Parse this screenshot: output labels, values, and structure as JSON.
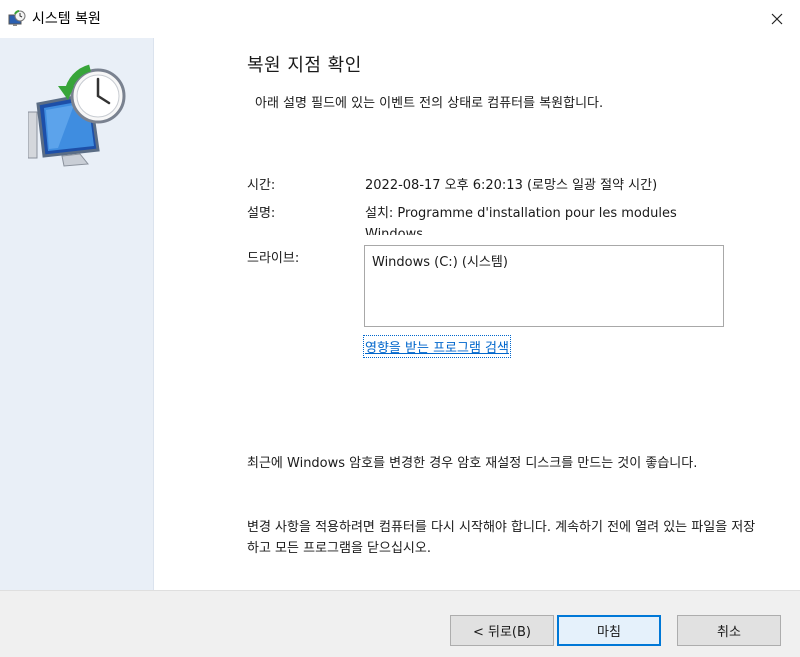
{
  "window": {
    "title": "시스템 복원"
  },
  "content": {
    "heading": "복원 지점 확인",
    "subheading": "아래 설명 필드에 있는 이벤트 전의 상태로 컴퓨터를 복원합니다.",
    "time_label": "시간:",
    "time_value": "2022-08-17 오후 6:20:13 (로망스 일광 절약 시간)",
    "desc_label": "설명:",
    "desc_value": "설치: Programme d'installation pour les modules Windows",
    "drive_label": "드라이브:",
    "drive_value": "Windows (C:) (시스템)",
    "affected_link": "영향을 받는 프로그램 검색",
    "note1": "최근에 Windows 암호를 변경한 경우 암호 재설정 디스크를 만드는 것이 좋습니다.",
    "note2": "변경 사항을 적용하려면 컴퓨터를 다시 시작해야 합니다. 계속하기 전에 열려 있는 파일을 저장하고 모든 프로그램을 닫으십시오."
  },
  "footer": {
    "back_label": "< 뒤로(B)",
    "finish_label": "마침",
    "cancel_label": "취소"
  },
  "colors": {
    "side_panel": "#e9eff7",
    "link": "#0066cc",
    "default_button_border": "#0078d7"
  }
}
